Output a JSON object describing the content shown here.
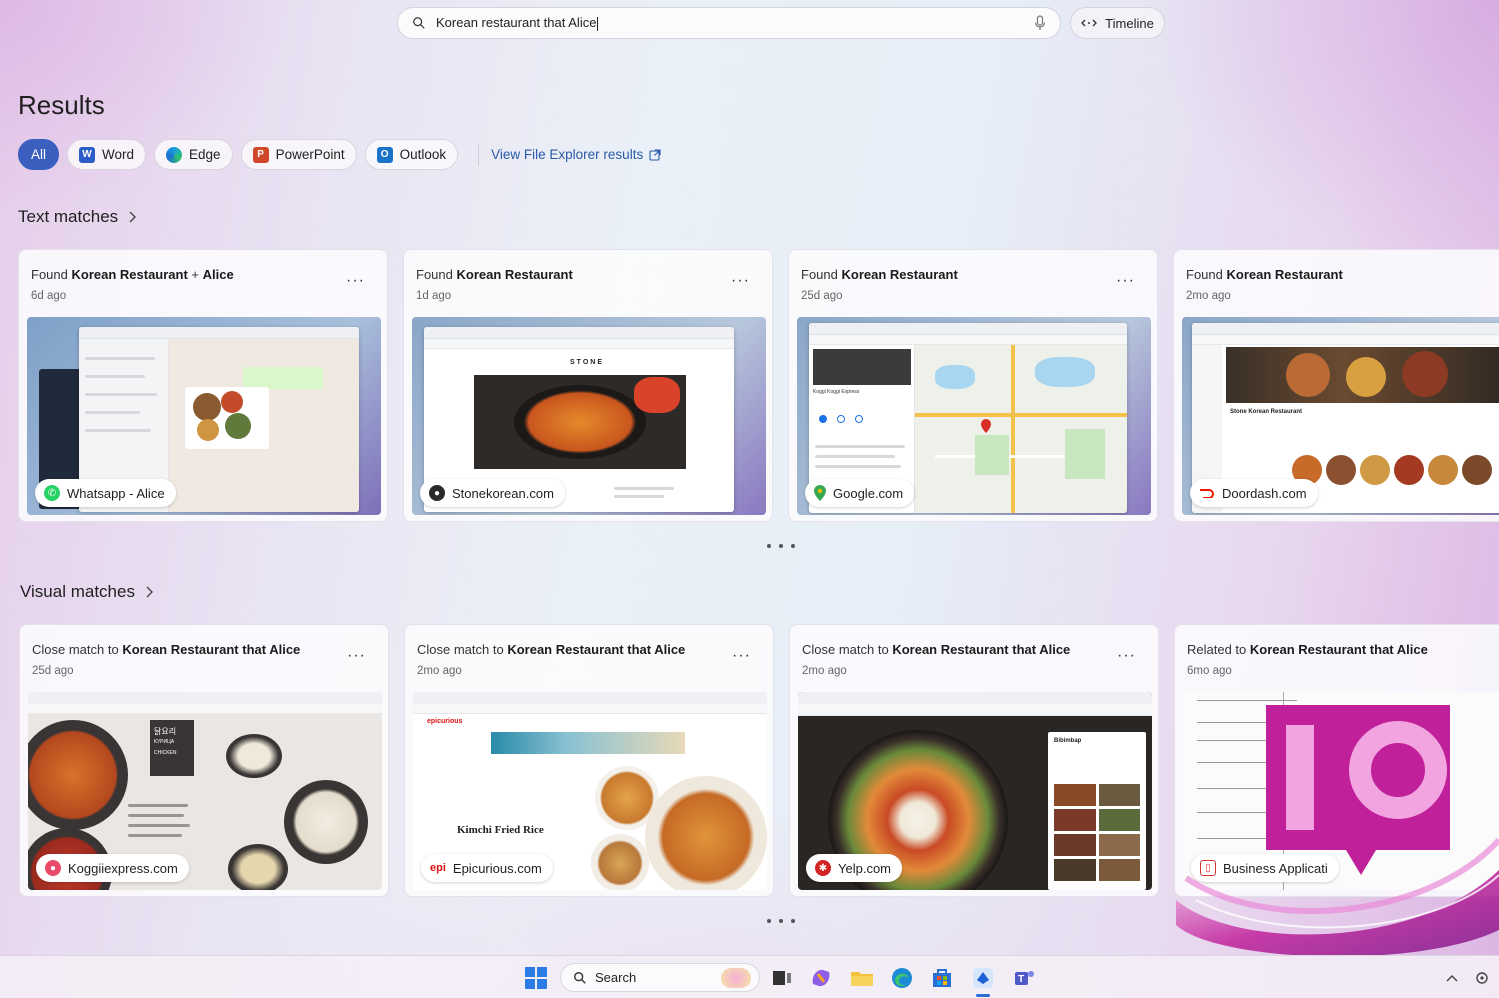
{
  "search": {
    "query": "Korean restaurant that Alice",
    "timeline_label": "Timeline"
  },
  "results": {
    "title": "Results",
    "filters": [
      "All",
      "Word",
      "Edge",
      "PowerPoint",
      "Outlook"
    ],
    "file_explorer_link": "View File Explorer results"
  },
  "text_matches": {
    "heading": "Text matches",
    "cards": [
      {
        "prefix": "Found ",
        "bold": "Korean Restaurant",
        "suffix": " + ",
        "bold2": "Alice",
        "ago": "6d ago",
        "source": "Whatsapp - Alice"
      },
      {
        "prefix": "Found ",
        "bold": "Korean Restaurant",
        "suffix": "",
        "bold2": "",
        "ago": "1d ago",
        "source": "Stonekorean.com"
      },
      {
        "prefix": "Found ",
        "bold": "Korean Restaurant",
        "suffix": "",
        "bold2": "",
        "ago": "25d ago",
        "source": "Google.com"
      },
      {
        "prefix": "Found ",
        "bold": "Korean Restaurant",
        "suffix": "",
        "bold2": "",
        "ago": "2mo ago",
        "source": "Doordash.com"
      }
    ]
  },
  "visual_matches": {
    "heading": "Visual matches",
    "cards": [
      {
        "prefix": "Close match to ",
        "bold": "Korean Restaurant that Alice",
        "ago": "25d ago",
        "source": "Koggiiexpress.com"
      },
      {
        "prefix": "Close match to ",
        "bold": "Korean Restaurant that Alice",
        "ago": "2mo ago",
        "source": "Epicurious.com"
      },
      {
        "prefix": "Close match to ",
        "bold": "Korean Restaurant that Alice",
        "ago": "2mo ago",
        "source": "Yelp.com"
      },
      {
        "prefix": "Related to ",
        "bold": "Korean Restaurant that Alice",
        "ago": "6mo ago",
        "source": "Business Applicati"
      }
    ]
  },
  "thumbnails": {
    "stone_logo": "STONE",
    "google_place": "Koggi Koggi Express",
    "doordash_store": "Stone Korean Restaurant",
    "kogi_korean": "닭요리",
    "kogi_russian": "КУРИЦА",
    "kogi_english": "CHICKEN",
    "epi_brand": "epicurious",
    "epi_dish": "Kimchi Fried Rice",
    "yelp_dish": "Bibimbap"
  },
  "taskbar": {
    "search_label": "Search"
  },
  "colors": {
    "accent": "#3b5fbf",
    "link": "#2a5aa8",
    "logo_magenta": "#c0209a"
  }
}
